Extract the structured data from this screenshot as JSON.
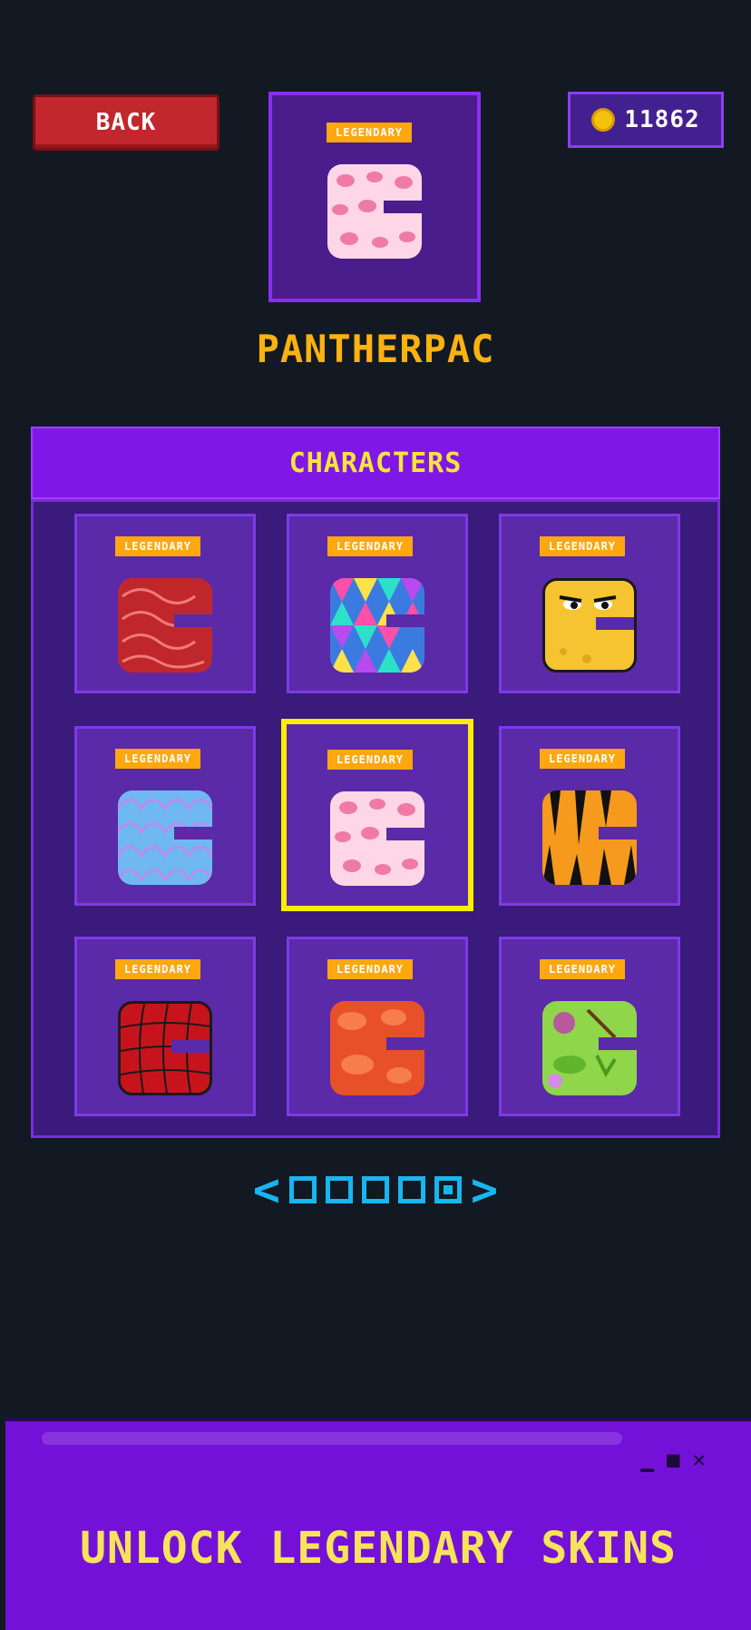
{
  "header": {
    "back_label": "BACK",
    "coins": "11862"
  },
  "preview": {
    "badge": "LEGENDARY",
    "skin_name": "PANTHERPAC",
    "skin_icon": "leopard-pac-icon"
  },
  "panel": {
    "title": "CHARACTERS",
    "skins": [
      {
        "badge": "LEGENDARY",
        "icon": "brain-pac-icon",
        "selected": false
      },
      {
        "badge": "LEGENDARY",
        "icon": "mosaic-pac-icon",
        "selected": false
      },
      {
        "badge": "LEGENDARY",
        "icon": "cheese-pac-icon",
        "selected": false
      },
      {
        "badge": "LEGENDARY",
        "icon": "scales-pac-icon",
        "selected": false
      },
      {
        "badge": "LEGENDARY",
        "icon": "leopard-pac-icon",
        "selected": true
      },
      {
        "badge": "LEGENDARY",
        "icon": "tiger-pac-icon",
        "selected": false
      },
      {
        "badge": "LEGENDARY",
        "icon": "spider-pac-icon",
        "selected": false
      },
      {
        "badge": "LEGENDARY",
        "icon": "lava-pac-icon",
        "selected": false
      },
      {
        "badge": "LEGENDARY",
        "icon": "zombie-pac-icon",
        "selected": false
      }
    ]
  },
  "pager": {
    "pages": 5,
    "active_page": 5
  },
  "banner": {
    "text": "UNLOCK LEGENDARY SKINS"
  },
  "colors": {
    "background": "#121923",
    "accent_purple": "#7f18e6",
    "badge_orange": "#ffa70f",
    "title_yellow": "#f7e53a",
    "selection_yellow": "#ffee00",
    "pager_blue": "#18b6f0"
  }
}
